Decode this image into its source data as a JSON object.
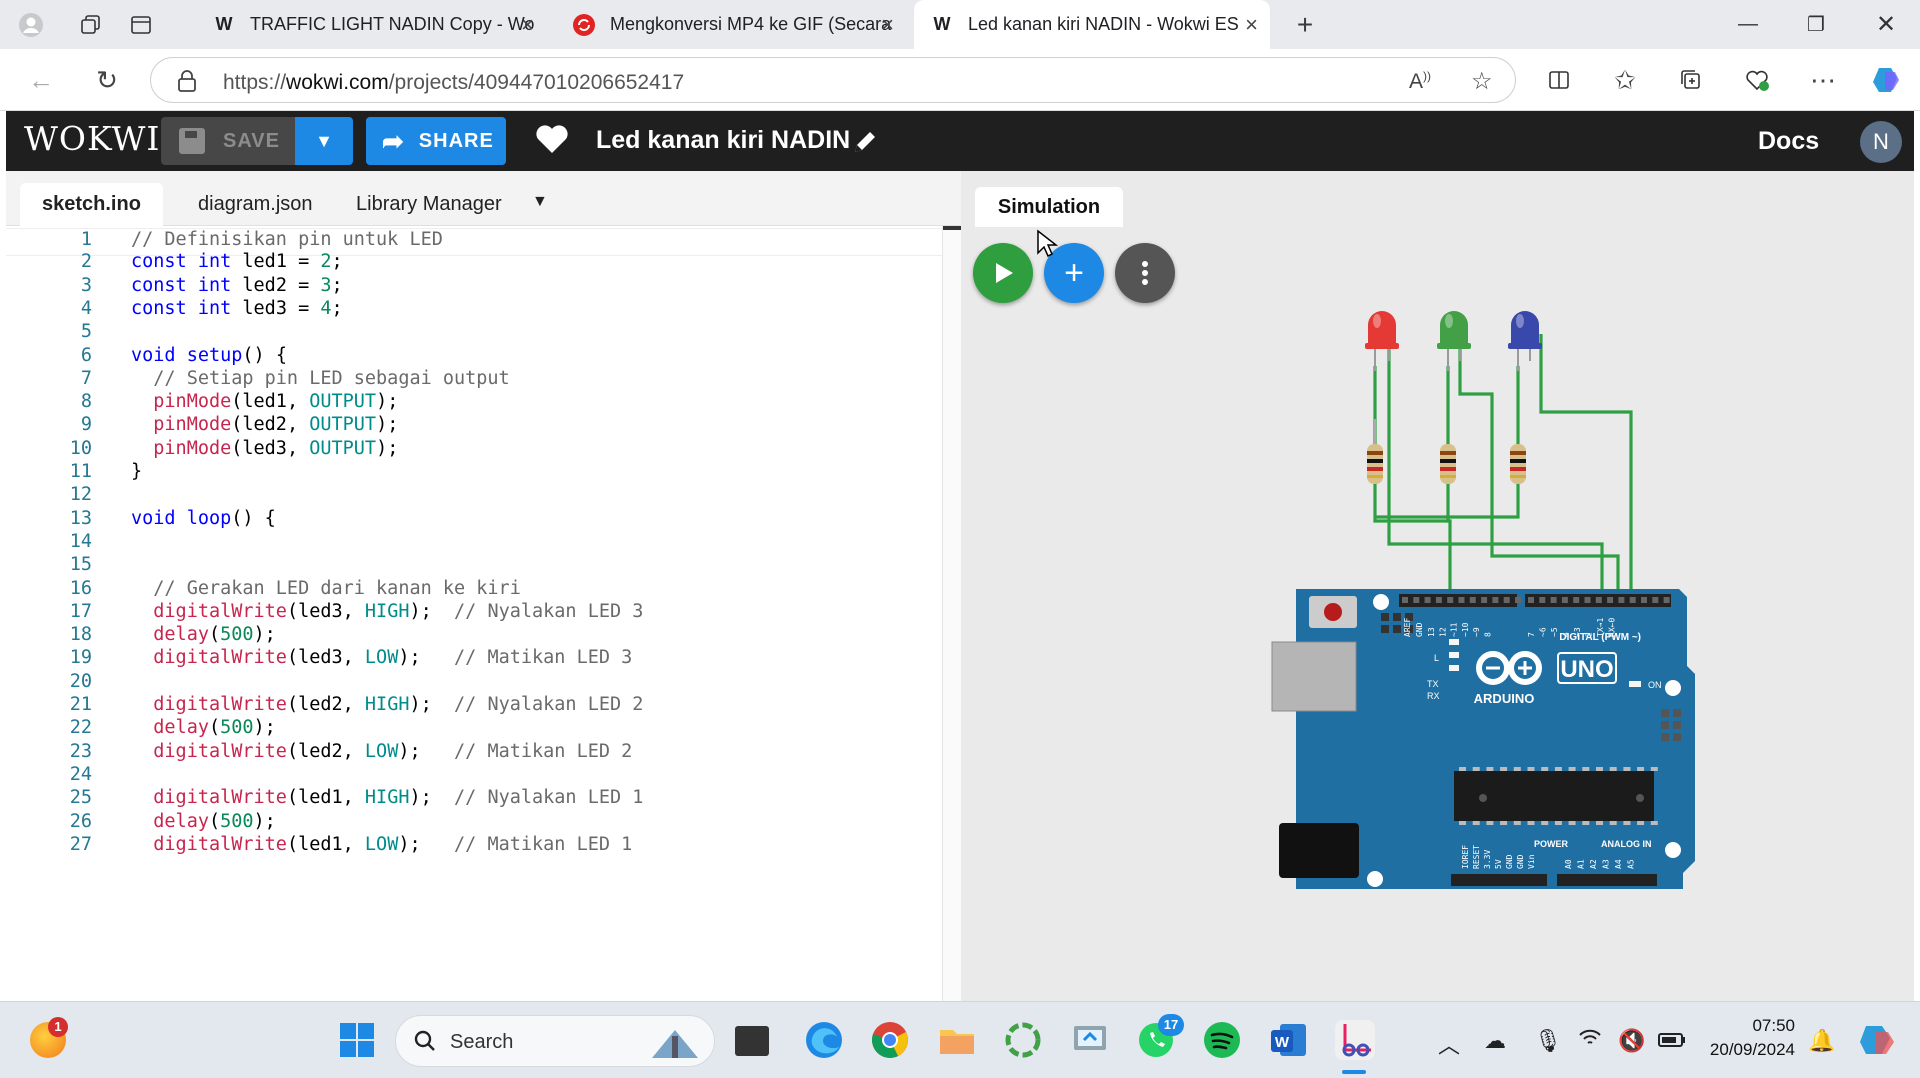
{
  "browser": {
    "tabs": [
      {
        "title": "TRAFFIC LIGHT NADIN Copy - Wo",
        "favicon": "wokwi-icon"
      },
      {
        "title": "Mengkonversi MP4 ke GIF (Secara",
        "favicon": "converter-icon"
      },
      {
        "title": "Led kanan kiri NADIN - Wokwi ES",
        "favicon": "wokwi-icon"
      }
    ],
    "url_prefix": "https://",
    "url_domain": "wokwi.com",
    "url_path": "/projects/409447010206652417"
  },
  "header": {
    "logo": "WOKWI",
    "save_label": "SAVE",
    "share_label": "SHARE",
    "project_title": "Led kanan kiri NADIN",
    "docs_label": "Docs",
    "avatar_initial": "N"
  },
  "editor": {
    "tabs": [
      "sketch.ino",
      "diagram.json",
      "Library Manager"
    ],
    "active_tab": "sketch.ino",
    "lines": [
      "// Definisikan pin untuk LED",
      "const int led1 = 2;",
      "const int led2 = 3;",
      "const int led3 = 4;",
      "",
      "void setup() {",
      "  // Setiap pin LED sebagai output",
      "  pinMode(led1, OUTPUT);",
      "  pinMode(led2, OUTPUT);",
      "  pinMode(led3, OUTPUT);",
      "}",
      "",
      "void loop() {",
      "",
      "",
      "  // Gerakan LED dari kanan ke kiri",
      "  digitalWrite(led3, HIGH);  // Nyalakan LED 3",
      "  delay(500);",
      "  digitalWrite(led3, LOW);   // Matikan LED 3",
      "",
      "  digitalWrite(led2, HIGH);  // Nyalakan LED 2",
      "  delay(500);",
      "  digitalWrite(led2, LOW);   // Matikan LED 2",
      "",
      "  digitalWrite(led1, HIGH);  // Nyalakan LED 1",
      "  delay(500);",
      "  digitalWrite(led1, LOW);   // Matikan LED 1"
    ]
  },
  "simulation": {
    "tab_label": "Simulation",
    "board": {
      "name": "UNO",
      "brand": "ARDUINO",
      "labels": {
        "digital": "DIGITAL (PWM ~)",
        "power": "POWER",
        "analog": "ANALOG IN",
        "on": "ON",
        "tx": "TX",
        "rx": "RX",
        "l": "L",
        "aref": "AREF",
        "gnd": "GND",
        "pins_digital": [
          "13",
          "12",
          "~11",
          "~10",
          "~9",
          "8",
          "7",
          "~6",
          "~5",
          "4",
          "~3",
          "2",
          "TX→1",
          "RX←0"
        ],
        "pins_power": [
          "IOREF",
          "RESET",
          "3.3V",
          "5V",
          "GND",
          "GND",
          "Vin"
        ],
        "pins_analog": [
          "A0",
          "A1",
          "A2",
          "A3",
          "A4",
          "A5"
        ]
      }
    },
    "leds": [
      {
        "color": "#e53935"
      },
      {
        "color": "#43a047"
      },
      {
        "color": "#3949ab"
      }
    ],
    "wire_color": "#2ea043",
    "board_color": "#1f6fa3"
  },
  "taskbar": {
    "search_label": "Search",
    "time": "07:50",
    "date": "20/09/2024",
    "whatsapp_badge": "17",
    "notification_badge": "1"
  }
}
